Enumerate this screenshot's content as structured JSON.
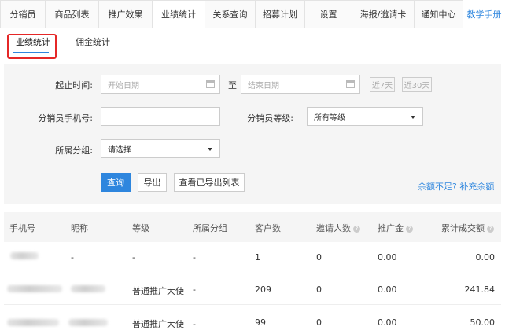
{
  "top_tabs": [
    {
      "label": "分销员"
    },
    {
      "label": "商品列表"
    },
    {
      "label": "推广效果"
    },
    {
      "label": "业绩统计"
    },
    {
      "label": "关系查询"
    },
    {
      "label": "招募计划"
    },
    {
      "label": "设置"
    },
    {
      "label": "海报/邀请卡"
    },
    {
      "label": "通知中心"
    },
    {
      "label": "教学手册"
    }
  ],
  "sub_tabs": [
    {
      "label": "业绩统计"
    },
    {
      "label": "佣金统计"
    }
  ],
  "filter": {
    "start_time_label": "起止时间:",
    "start_placeholder": "开始日期",
    "to_label": "至",
    "end_placeholder": "结束日期",
    "last7": "近7天",
    "last30": "近30天",
    "phone_label": "分销员手机号:",
    "level_label": "分销员等级:",
    "level_value": "所有等级",
    "group_label": "所属分组:",
    "group_value": "请选择",
    "query_button": "查询",
    "export_button": "导出",
    "exported_list_button": "查看已导出列表",
    "topup_link": "余额不足? 补充余额"
  },
  "table": {
    "headers": [
      "手机号",
      "昵称",
      "等级",
      "所属分组",
      "客户数",
      "邀请人数",
      "推广金",
      "累计成交额"
    ],
    "rows": [
      {
        "level": "-",
        "nickname": "-",
        "group": "-",
        "customers": "1",
        "invited": "0",
        "promo": "0.00",
        "total": "0.00"
      },
      {
        "level": "普通推广大使",
        "group": "-",
        "customers": "209",
        "invited": "0",
        "promo": "0.00",
        "total": "241.84"
      },
      {
        "level": "普通推广大使",
        "group": "-",
        "customers": "99",
        "invited": "0",
        "promo": "0.00",
        "total": "50.00"
      }
    ]
  }
}
